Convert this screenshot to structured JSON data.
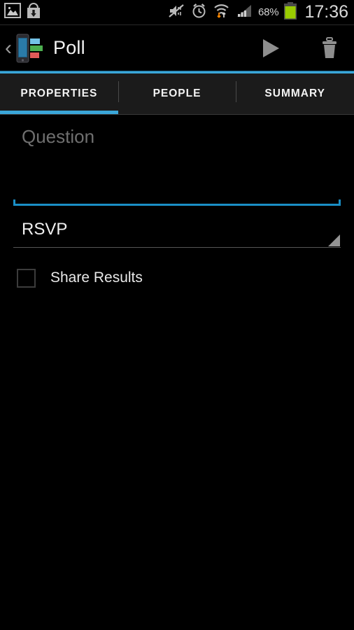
{
  "status_bar": {
    "left_icons": [
      {
        "name": "gallery-image-icon",
        "label": "Screenshot captured"
      },
      {
        "name": "download-bag-icon",
        "label": "App download"
      }
    ],
    "right_icons": [
      {
        "name": "sound-mute-icon",
        "label": "Sound off"
      },
      {
        "name": "alarm-clock-icon",
        "label": "Alarm set"
      },
      {
        "name": "wifi-transfer-icon",
        "label": "Wi-Fi connected"
      },
      {
        "name": "cellular-signal-icon",
        "label": "Cellular signal"
      }
    ],
    "battery_percent": "68%",
    "battery_color": "#99cc00",
    "time": "17:36"
  },
  "action_bar": {
    "back_chevron": "‹",
    "app_icon": "poll-app-icon",
    "title": "Poll",
    "actions": [
      {
        "name": "send-poll-button",
        "icon": "play-icon"
      },
      {
        "name": "delete-poll-button",
        "icon": "trash-icon"
      }
    ],
    "accent_color": "#3aa6d8"
  },
  "tabs": {
    "items": [
      {
        "label": "PROPERTIES",
        "active": true
      },
      {
        "label": "PEOPLE",
        "active": false
      },
      {
        "label": "SUMMARY",
        "active": false
      }
    ],
    "indicator_color": "#3aa6d8"
  },
  "form": {
    "question": {
      "value": "",
      "placeholder": "Question",
      "underline_color": "#1a8fc6"
    },
    "poll_type": {
      "selected": "RSVP",
      "options": [
        "RSVP"
      ],
      "arrow_icon": "dropdown-triangle-icon"
    },
    "share_results": {
      "label": "Share Results",
      "checked": false
    }
  }
}
